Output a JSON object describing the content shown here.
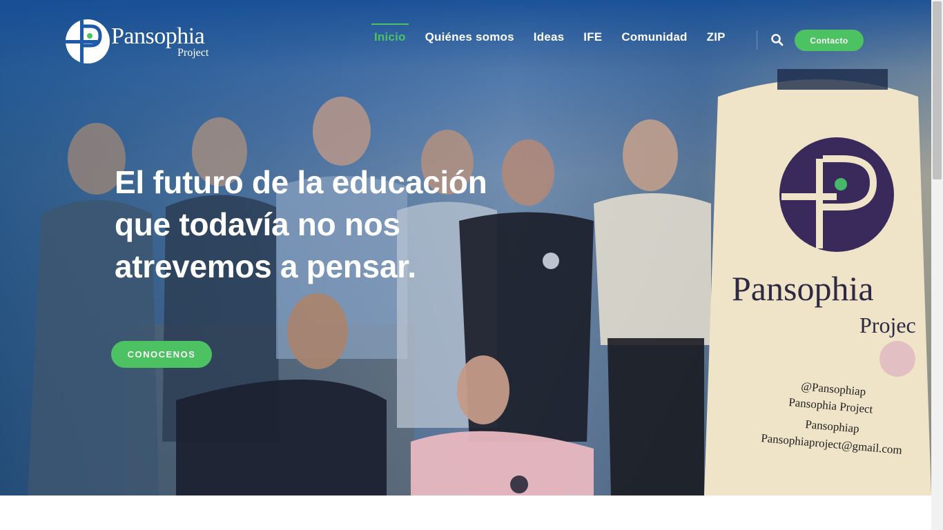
{
  "brand": {
    "name": "Pansophia",
    "sub": "Project"
  },
  "nav": {
    "items": [
      {
        "label": "Inicio",
        "active": true
      },
      {
        "label": "Quiénes somos",
        "active": false
      },
      {
        "label": "Ideas",
        "active": false
      },
      {
        "label": "IFE",
        "active": false
      },
      {
        "label": "Comunidad",
        "active": false
      },
      {
        "label": "ZIP",
        "active": false
      }
    ],
    "search_icon": "search-icon",
    "contact_label": "Contacto"
  },
  "hero": {
    "headline_lines": [
      "El futuro de la educación",
      "que todavía no nos",
      "atrevemos a pensar."
    ],
    "cta_label": "CONOCENOS"
  },
  "banner": {
    "brand_name": "Pansophia",
    "brand_sub": "Projec",
    "twitter": "@Pansophiap",
    "facebook": "Pansophia Project",
    "instagram": "Pansophiap",
    "email": "Pansophiaproject@gmail.com"
  },
  "colors": {
    "accent": "#4cc262",
    "nav_top": "#164e96",
    "banner_purple": "#3a2a5c"
  }
}
